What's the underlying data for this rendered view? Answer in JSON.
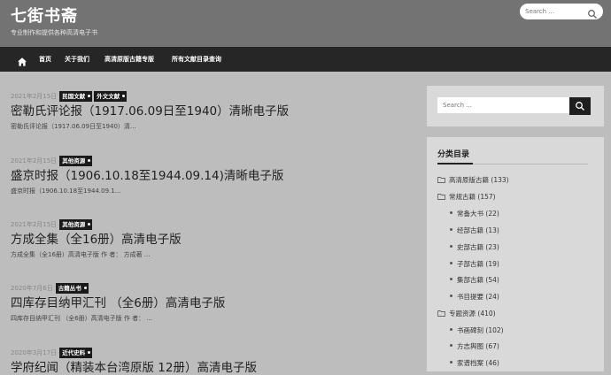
{
  "site": {
    "title": "七街书斋",
    "description": "专业制作和提供各种高清电子书"
  },
  "top_search": {
    "placeholder": "Search ..."
  },
  "nav": {
    "items": [
      "首页",
      "关于我们",
      "高清原版古籍专版",
      "所有文献目录查询"
    ]
  },
  "posts": [
    {
      "date": "2021年2月15日",
      "tags": [
        "民国文献",
        "外文文献"
      ],
      "title": "密勒氏评论报（1917.06.09日至1940）清晰电子版",
      "excerpt": "密勒氏评论报（1917.06.09日至1940）清..."
    },
    {
      "date": "2021年2月15日",
      "tags": [
        "其他资源"
      ],
      "title": "盛京时报（1906.10.18至1944.09.14)清晰电子版",
      "excerpt": "盛京时报（1906.10.18至1944.09.1..."
    },
    {
      "date": "2021年2月15日",
      "tags": [
        "其他资源"
      ],
      "title": "方成全集（全16册）高清电子版",
      "excerpt": "方成全集（全16册）高清电子版 作 者： 方成著 ..."
    },
    {
      "date": "2020年7月6日",
      "tags": [
        "古籍丛书"
      ],
      "title": "四库存目纳甲汇刊 （全6册）高清电子版",
      "excerpt": "四库存目纳甲汇刊 （全6册）高清电子版 作 者： ..."
    },
    {
      "date": "2020年3月17日",
      "tags": [
        "近代史料"
      ],
      "title": "学府纪闻（精装本台湾原版 12册）高清电子版",
      "excerpt": ""
    }
  ],
  "sidebar": {
    "search_placeholder": "Search ...",
    "categories_title": "分类目录",
    "categories": [
      {
        "label": "高清原版古籍",
        "count": "(133)"
      },
      {
        "label": "常规古籍",
        "count": "(157)"
      },
      {
        "label": "常备大书",
        "count": "(22)"
      },
      {
        "label": "经部古籍",
        "count": "(13)"
      },
      {
        "label": "史部古籍",
        "count": "(23)"
      },
      {
        "label": "子部古籍",
        "count": "(19)"
      },
      {
        "label": "集部古籍",
        "count": "(54)"
      },
      {
        "label": "书目提要",
        "count": "(24)"
      },
      {
        "label": "专题资源",
        "count": "(410)"
      },
      {
        "label": "书画碑刻",
        "count": "(102)"
      },
      {
        "label": "方志舆图",
        "count": "(67)"
      },
      {
        "label": "家谱档案",
        "count": "(46)"
      }
    ]
  },
  "icons": {
    "home": "home-icon",
    "search": "search-icon",
    "folder": "folder-icon"
  },
  "colors": {
    "header_bg": "#737373",
    "nav_bg": "#262626",
    "tag_bg": "#1a1a1a",
    "page_bg": "#bdbdbd",
    "widget_bg": "#d9d9d9"
  }
}
